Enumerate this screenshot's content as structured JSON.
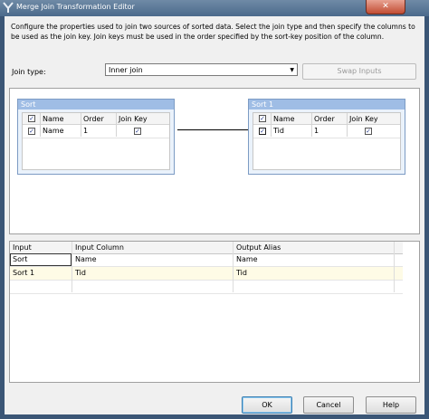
{
  "window": {
    "title": "Merge Join Transformation Editor",
    "close_glyph": "✕"
  },
  "description": "Configure the properties used to join two sources of sorted data. Select the join type and then specify the columns to be used as the join key. Join keys must be used in the order specified by the sort-key position of the column.",
  "join": {
    "label": "Join type:",
    "selected": "Inner join",
    "swap_label": "Swap Inputs"
  },
  "left_table": {
    "title": "Sort",
    "headers": [
      "Name",
      "Order",
      "Join Key"
    ],
    "rows": [
      {
        "name": "Name",
        "order": "1",
        "checked": true,
        "join_key": true
      }
    ]
  },
  "right_table": {
    "title": "Sort 1",
    "headers": [
      "Name",
      "Order",
      "Join Key"
    ],
    "rows": [
      {
        "name": "Tid",
        "order": "1",
        "checked": true,
        "join_key": true
      }
    ]
  },
  "output": {
    "headers": [
      "Input",
      "Input Column",
      "Output Alias"
    ],
    "rows": [
      {
        "input": "Sort",
        "column": "Name",
        "alias": "Name"
      },
      {
        "input": "Sort 1",
        "column": "Tid",
        "alias": "Tid"
      }
    ]
  },
  "buttons": {
    "ok": "OK",
    "cancel": "Cancel",
    "help": "Help"
  },
  "icons": {
    "app": "merge-join-icon",
    "check": "✓"
  },
  "colors": {
    "title_bar": "#4b6a8b",
    "table_header": "#9fbde5",
    "selected_row": "#fefbe6",
    "close": "#c14c32"
  }
}
